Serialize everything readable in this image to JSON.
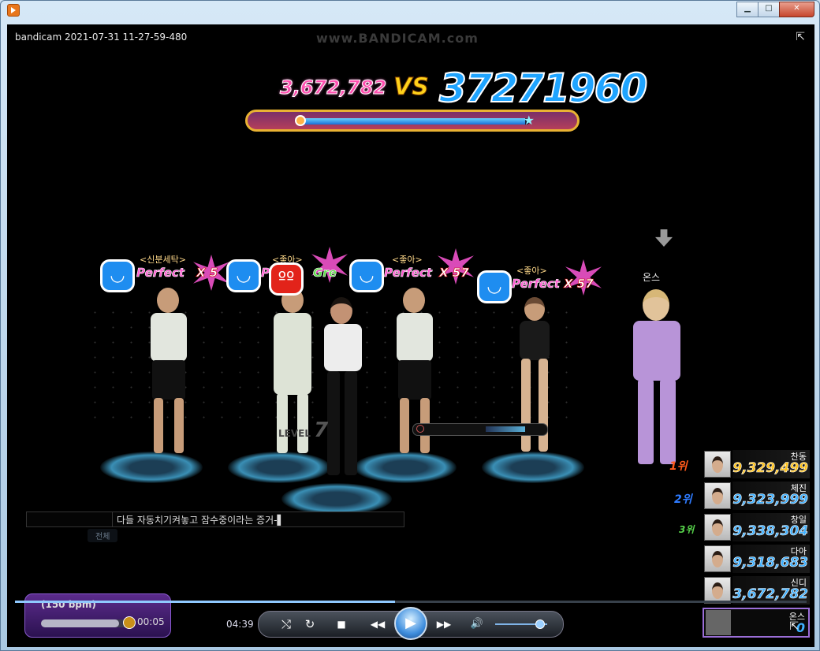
{
  "window": {
    "minimize_glyph": "▁",
    "maximize_glyph": "□",
    "close_glyph": "✕",
    "caption": "bandicam 2021-07-31 11-27-59-480",
    "watermark": "www.BANDICAM.com",
    "fullscreen_glyph": "⇱"
  },
  "game": {
    "score_left": "3,672,782",
    "vs_label": "VS",
    "score_right": "37271960",
    "match_progress": 0.98,
    "dancers": [
      {
        "tag": "<신분세탁>",
        "result": "Perfect",
        "combo": "X 5",
        "face": "◡"
      },
      {
        "tag": "<좋아>",
        "result": "Gre",
        "combo": "",
        "face": "ºº"
      },
      {
        "tag": "<좋아>",
        "result": "Perfect",
        "combo": "X 57",
        "face": "◡"
      },
      {
        "tag": "<좋아>",
        "result": "Perfect",
        "combo": "X 57",
        "face": "◡"
      }
    ],
    "result_fragment": "P",
    "player_name": "온스",
    "level_label": "LEVEL",
    "level_value": "7",
    "chat_text": "다들 자동치기켜놓고 잠수중이라는 증거-▌",
    "chat_tab": "전체",
    "rankings": [
      {
        "badge": "1위",
        "name": "찬동",
        "score": "9,329,499",
        "color": "#ffc21a"
      },
      {
        "badge": "2위",
        "name": "체진",
        "score": "9,323,999",
        "color": "#3fb0ff"
      },
      {
        "badge": "3위",
        "name": "창일",
        "score": "9,338,304",
        "color": "#3fb0ff"
      },
      {
        "badge": "",
        "name": "다아",
        "score": "9,318,683",
        "color": "#3fb0ff"
      },
      {
        "badge": "",
        "name": "신디",
        "score": "3,672,782",
        "color": "#3fb0ff"
      }
    ],
    "me": {
      "name": "온스",
      "score": "0"
    },
    "song": {
      "bpm": "(150 bpm)",
      "time": "00:05",
      "progress": 0.88
    }
  },
  "player": {
    "elapsed": "04:39",
    "seek_progress": 0.48,
    "btn_repeat": "⤭",
    "btn_reload": "↻",
    "btn_stop": "■",
    "btn_prev": "◀◀",
    "btn_play": "▶",
    "btn_next": "▶▶",
    "btn_volume": "🔊",
    "volume": 0.85
  }
}
